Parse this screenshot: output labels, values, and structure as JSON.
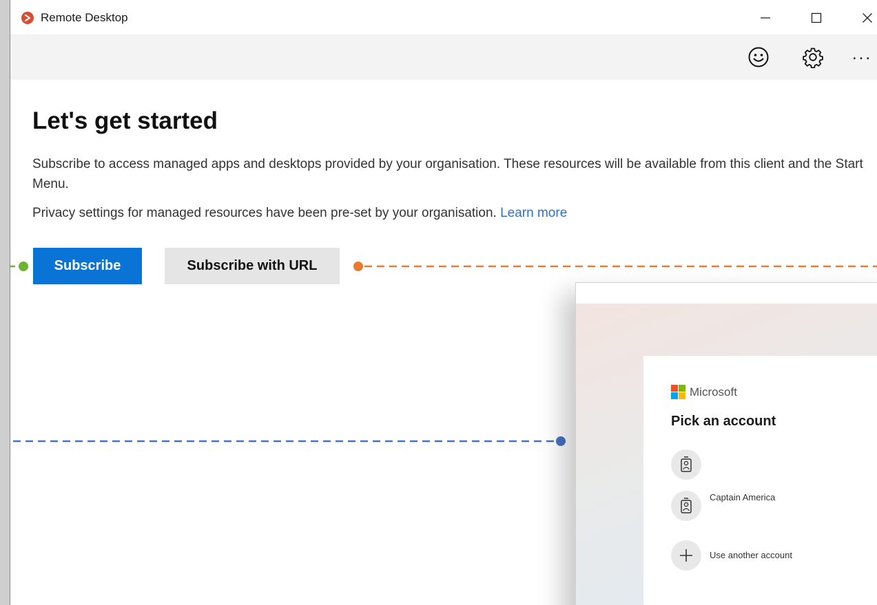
{
  "window": {
    "title": "Remote Desktop",
    "controls": {
      "minimize": "minimize",
      "maximize": "maximize",
      "close": "close"
    }
  },
  "toolbar": {
    "icons": [
      "feedback-smiley-icon",
      "gear-icon",
      "more-ellipsis-icon"
    ],
    "more_label": "..."
  },
  "main": {
    "heading": "Let's get started",
    "description": "Subscribe to access managed apps and desktops provided by your organisation. These resources will be available from this client and the Start Menu.",
    "privacy_text": "Privacy settings for managed resources have been pre-set by your organisation.",
    "learn_more": "Learn more",
    "subscribe_label": "Subscribe",
    "subscribe_url_label": "Subscribe with URL"
  },
  "annotations": {
    "colors": {
      "green": "#6bb52e",
      "orange": "#ea7a2c",
      "blue": "#4472c4"
    }
  },
  "account_picker": {
    "brand": "Microsoft",
    "title": "Pick an account",
    "accounts": [
      {
        "name": ""
      },
      {
        "name": "Captain America"
      }
    ],
    "add_account": "Use another account"
  },
  "colors": {
    "primary": "#0a74d6",
    "secondary_button": "#e5e5e5",
    "link": "#2b73c9",
    "app_icon": "#e04a2e"
  }
}
